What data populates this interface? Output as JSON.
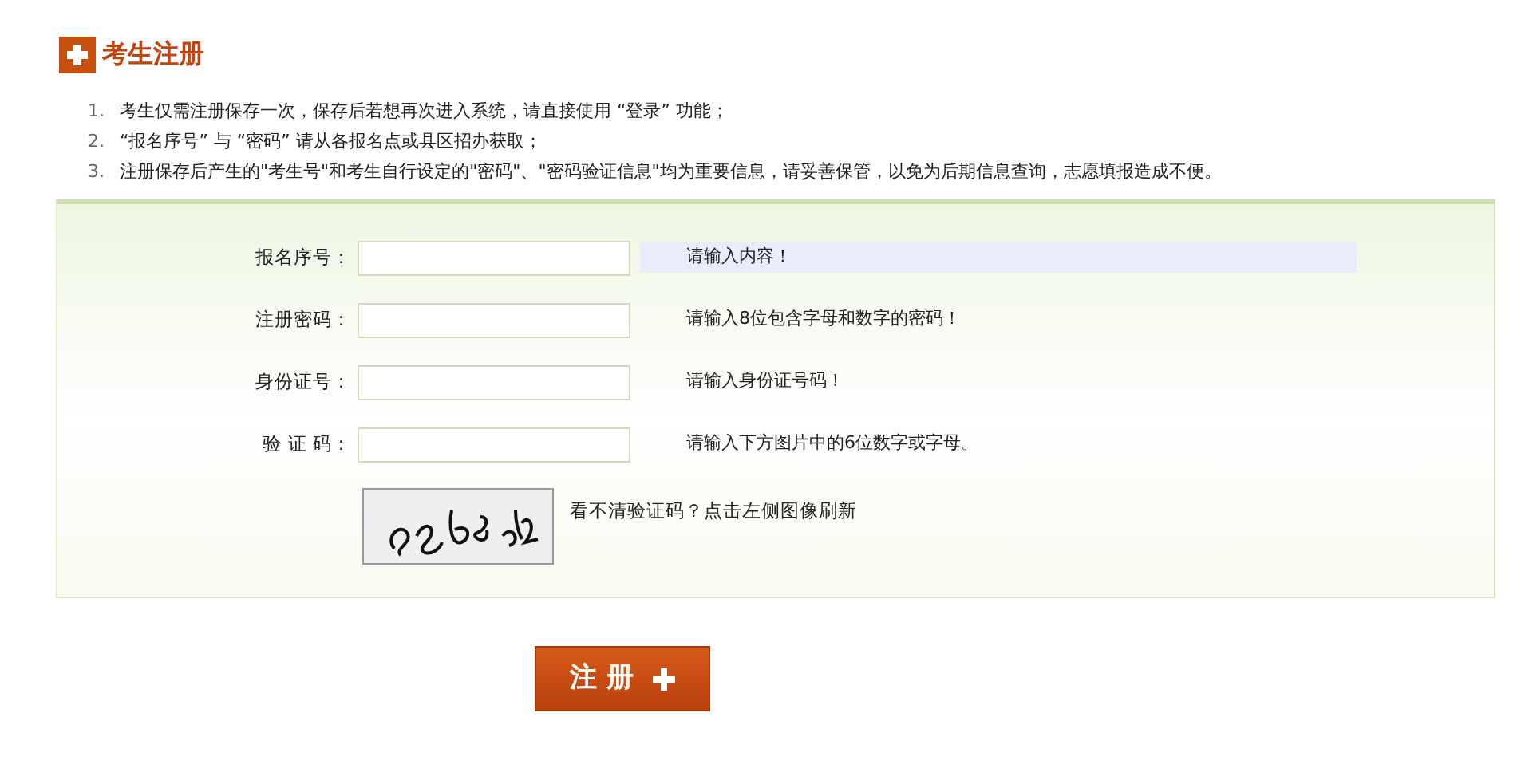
{
  "title": "考生注册",
  "notes": [
    {
      "number": "1.",
      "text": "考生仅需注册保存一次，保存后若想再次进入系统，请直接使用 “登录” 功能；"
    },
    {
      "number": "2.",
      "text": "“报名序号” 与 “密码” 请从各报名点或县区招办获取；"
    },
    {
      "number": "3.",
      "text": "注册保存后产生的\"考生号\"和考生自行设定的\"密码\"、\"密码验证信息\"均为重要信息，请妥善保管，以免为后期信息查询，志愿填报造成不便。"
    }
  ],
  "fields": [
    {
      "label": "报名序号：",
      "hint": "请输入内容！",
      "highlighted": true
    },
    {
      "label": "注册密码：",
      "hint": "请输入8位包含字母和数字的密码！",
      "highlighted": false
    },
    {
      "label": "身份证号：",
      "hint": "请输入身份证号码！",
      "highlighted": false
    },
    {
      "label": "验 证 码：",
      "hint": "请输入下方图片中的6位数字或字母。",
      "highlighted": false
    }
  ],
  "captcha": {
    "kind": "picture",
    "refresh_text": "看不清验证码？点击左侧图像刷新"
  },
  "submit_button": "注 册"
}
